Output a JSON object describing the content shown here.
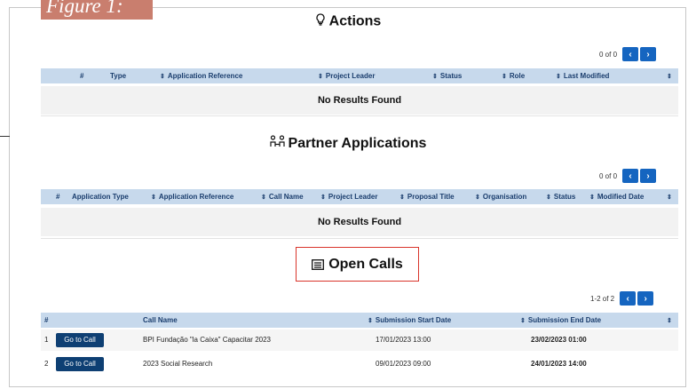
{
  "figure_label": "Figure 1:",
  "actions": {
    "title": "Actions",
    "pager": {
      "count": "0 of 0",
      "prev": "‹",
      "next": "›"
    },
    "columns": [
      "#",
      "Type",
      "Application Reference",
      "Project Leader",
      "Status",
      "Role",
      "Last Modified"
    ],
    "empty_text": "No Results Found"
  },
  "partner": {
    "title": "Partner Applications",
    "pager": {
      "count": "0 of 0",
      "prev": "‹",
      "next": "›"
    },
    "columns": [
      "#",
      "Application Type",
      "Application Reference",
      "Call Name",
      "Project Leader",
      "Proposal Title",
      "Organisation",
      "Status",
      "Modified Date"
    ],
    "empty_text": "No Results Found"
  },
  "open_calls": {
    "title": "Open Calls",
    "pager": {
      "count": "1-2 of 2",
      "prev": "‹",
      "next": "›"
    },
    "columns": [
      "#",
      "Call Name",
      "Submission Start Date",
      "Submission End Date"
    ],
    "rows": [
      {
        "num": "1",
        "button": "Go to Call",
        "call_name": "BPI Fundação \"la Caixa\" Capacitar 2023",
        "start": "17/01/2023 13:00",
        "end": "23/02/2023 01:00"
      },
      {
        "num": "2",
        "button": "Go to Call",
        "call_name": "2023 Social Research",
        "start": "09/01/2023 09:00",
        "end": "24/01/2023 14:00"
      }
    ]
  },
  "icons": {
    "actions": "lightbulb-icon",
    "partner": "people-link-icon",
    "open_calls": "list-icon",
    "sort": "sort-icon"
  }
}
